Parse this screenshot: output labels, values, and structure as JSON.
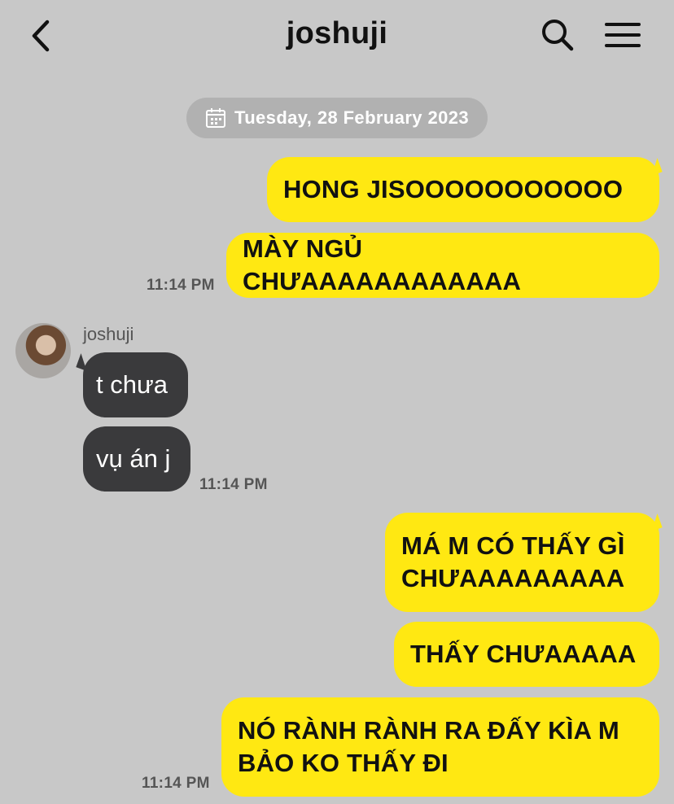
{
  "header": {
    "title": "joshuji"
  },
  "date_divider": "Tuesday, 28 February 2023",
  "messages": [
    {
      "text": "HONG JISOOOOOOOOOOO"
    },
    {
      "text": "MÀY NGỦ CHƯAAAAAAAAAAAA",
      "time": "11:14 PM"
    },
    {
      "sender": "joshuji",
      "text": "t chưa"
    },
    {
      "text": "vụ án j",
      "time": "11:14 PM"
    },
    {
      "line1": "MÁ M CÓ THẤY GÌ",
      "line2": "CHƯAAAAAAAAA"
    },
    {
      "text": "THẤY CHƯAAAAA"
    },
    {
      "line1": "NÓ RÀNH RÀNH RA ĐẤY KÌA M",
      "line2": "BẢO KO THẤY ĐI",
      "time": "11:14 PM"
    }
  ],
  "colors": {
    "background": "#c8c8c8",
    "outgoing_bubble": "#ffe812",
    "incoming_bubble": "#3a3a3c",
    "date_pill": "#b1b1b1"
  },
  "icons": [
    "back-chevron-icon",
    "search-icon",
    "menu-icon",
    "calendar-icon"
  ]
}
